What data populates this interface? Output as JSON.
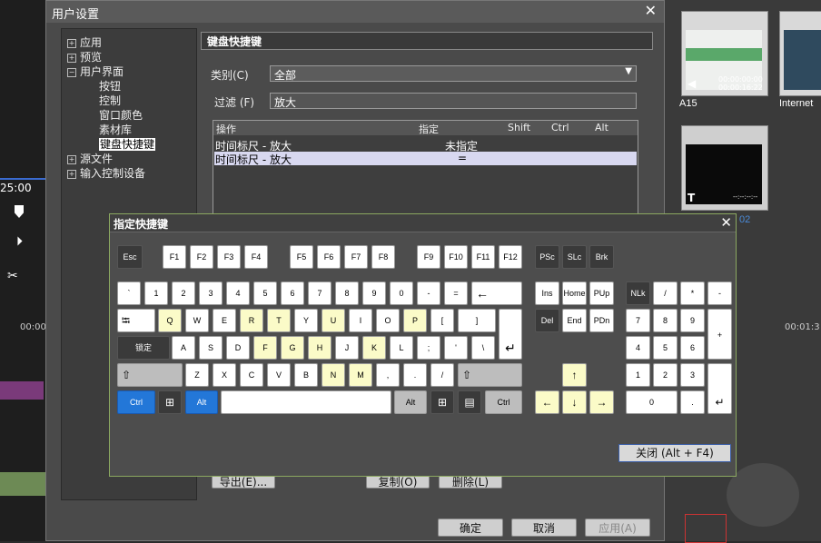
{
  "timeline": {
    "timecode": "25:00",
    "ruler_left": "00:00",
    "ruler_right": "00:01:3"
  },
  "bin": {
    "clip1": {
      "label": "A15",
      "tc1": "00:00:00:00",
      "tc2": "00:00:16:22"
    },
    "clip2": {
      "label": "Internet"
    },
    "clip3": {
      "text": "--:--:--:--",
      "tag": "02"
    }
  },
  "settings": {
    "title": "用户设置",
    "tree": [
      {
        "label": "应用",
        "pm": "+"
      },
      {
        "label": "预览",
        "pm": "+"
      },
      {
        "label": "用户界面",
        "pm": "−"
      },
      {
        "label": "按钮",
        "pm": ""
      },
      {
        "label": "控制",
        "pm": ""
      },
      {
        "label": "窗口颜色",
        "pm": ""
      },
      {
        "label": "素材库",
        "pm": ""
      },
      {
        "label": "键盘快捷键",
        "pm": ""
      },
      {
        "label": "源文件",
        "pm": "+"
      },
      {
        "label": "输入控制设备",
        "pm": "+"
      }
    ],
    "section_title": "键盘快捷键",
    "category_label": "类别(C)",
    "category_value": "全部",
    "filter_label": "过滤 (F)",
    "filter_value": "放大",
    "columns": [
      "操作",
      "指定",
      "Shift",
      "Ctrl",
      "Alt"
    ],
    "rows": [
      {
        "action": "时间标尺 - 放大",
        "assigned": "未指定"
      },
      {
        "action": "时间标尺 - 放大",
        "assigned": "="
      }
    ],
    "export_label": "导出(E)...",
    "copy_label": "复制(O)",
    "delete_label": "删除(L)",
    "ok_label": "确定",
    "cancel_label": "取消",
    "apply_label": "应用(A)"
  },
  "shortcut": {
    "title": "指定快捷键",
    "close_label": "关闭 (Alt + F4)",
    "keys": {
      "esc": "Esc",
      "f1": "F1",
      "f2": "F2",
      "f3": "F3",
      "f4": "F4",
      "f5": "F5",
      "f6": "F6",
      "f7": "F7",
      "f8": "F8",
      "f9": "F9",
      "f10": "F10",
      "f11": "F11",
      "f12": "F12",
      "psc": "PSc",
      "slc": "SLc",
      "brk": "Brk",
      "backtick": "`",
      "n1": "1",
      "n2": "2",
      "n3": "3",
      "n4": "4",
      "n5": "5",
      "n6": "6",
      "n7": "7",
      "n8": "8",
      "n9": "9",
      "n0": "0",
      "minus": "-",
      "equals": "=",
      "backspace": "←",
      "tab": "⭾",
      "q": "Q",
      "w": "W",
      "e": "E",
      "r": "R",
      "t": "T",
      "y": "Y",
      "u": "U",
      "i": "I",
      "o": "O",
      "p": "P",
      "lbracket": "[",
      "rbracket": "]",
      "caps": "锁定",
      "a": "A",
      "s": "S",
      "d": "D",
      "f": "F",
      "g": "G",
      "h": "H",
      "j": "J",
      "k": "K",
      "l": "L",
      "semicolon": ";",
      "quote": "'",
      "backslash": "\\",
      "enter": "↵",
      "shift_l": "⇧",
      "shift_r": "⇧",
      "z": "Z",
      "x": "X",
      "c": "C",
      "v": "V",
      "b": "B",
      "n": "N",
      "m": "M",
      "comma": ",",
      "period": ".",
      "slash": "/",
      "ctrl_l": "Ctrl",
      "alt_l": "Alt",
      "alt_r": "Alt",
      "ctrl_r": "Ctrl",
      "win_l": "⊞",
      "win_r": "⊞",
      "menu": "▤",
      "ins": "Ins",
      "home": "Home",
      "pup": "PUp",
      "del": "Del",
      "end": "End",
      "pdn": "PDn",
      "up": "↑",
      "left": "←",
      "down": "↓",
      "right": "→",
      "nlk": "NLk",
      "np_div": "/",
      "np_mul": "*",
      "np_sub": "-",
      "np7": "7",
      "np8": "8",
      "np9": "9",
      "np_add": "+",
      "np4": "4",
      "np5": "5",
      "np6": "6",
      "np1": "1",
      "np2": "2",
      "np3": "3",
      "np_enter": "↵",
      "np0": "0",
      "np_dot": "."
    }
  },
  "colors": {
    "highlight_key": "#fbfbc8",
    "active_key": "#2377d8",
    "dark_key": "#3a3a3a",
    "dialog_border": "#8ba860"
  }
}
